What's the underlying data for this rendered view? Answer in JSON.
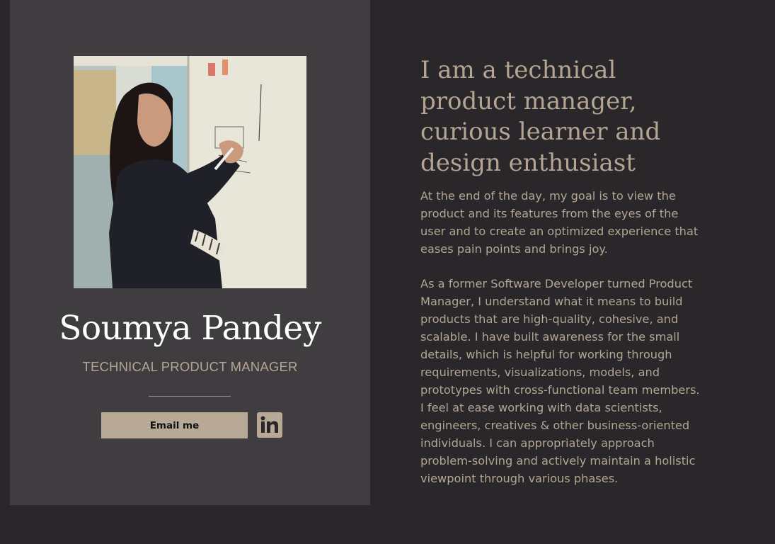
{
  "profile": {
    "name": "Soumya Pandey",
    "role": "TECHNICAL PRODUCT MANAGER",
    "email_button": "Email me",
    "linkedin_icon": "linkedin-icon",
    "photo_icon": "profile-photo"
  },
  "intro": {
    "headline": "I am a technical product manager, curious learner and design enthusiast",
    "paragraph_1": "At the end of the day, my goal is to view the product and its features from the eyes of the user and to create an optimized experience that eases pain points and brings joy.",
    "paragraph_2": "As a former Software Developer turned Product Manager, I understand what it means to build products that are high-quality, cohesive, and scalable. I have built awareness for the small details, which is helpful for working through requirements, visualizations, models, and prototypes with cross-functional team members. I feel at ease working with data scientists, engineers, creatives & other business-oriented individuals. I can appropriately approach problem-solving and actively maintain a holistic viewpoint through various phases."
  },
  "colors": {
    "page_background": "#2a272b",
    "card_background": "#403d41",
    "accent": "#b8a997",
    "text_tan": "#b4a593",
    "name_text": "#ffffff"
  }
}
